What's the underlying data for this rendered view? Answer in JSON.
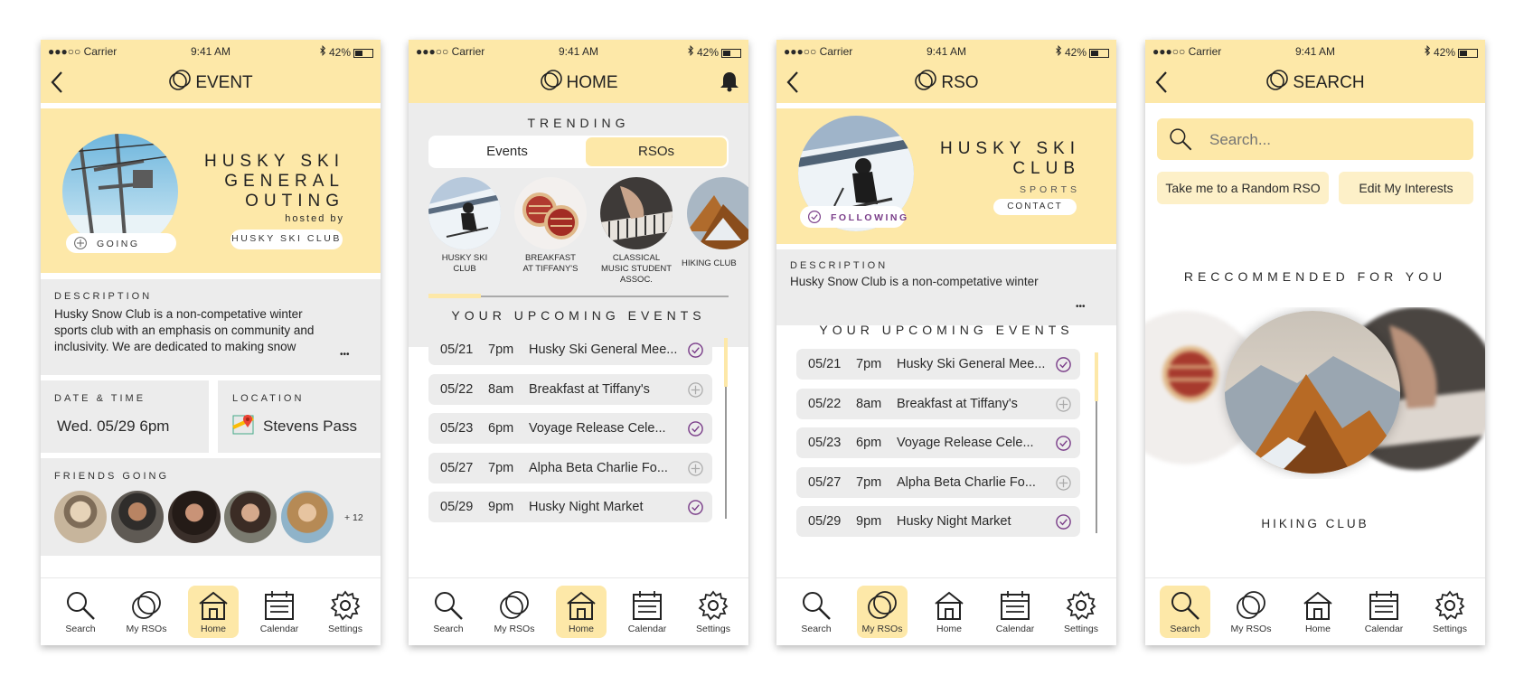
{
  "status": {
    "carrier": "●●●○○ Carrier",
    "time": "9:41 AM",
    "battery": "42%"
  },
  "colors": {
    "accent": "#fde8a8",
    "panel": "#ececec",
    "check": "#7b3f8a"
  },
  "nav": {
    "search": "Search",
    "my_rsos": "My RSOs",
    "home": "Home",
    "calendar": "Calendar",
    "settings": "Settings"
  },
  "event_screen": {
    "title": "EVENT",
    "event_name": [
      "HUSKY SKI",
      "GENERAL",
      "OUTING"
    ],
    "hosted_by": "hosted by",
    "host": "HUSKY SKI CLUB",
    "going": "GOING",
    "description_label": "DESCRIPTION",
    "description": "Husky Snow Club is a non-competative winter sports club with an emphasis on community and inclusivity. We are dedicated to making snow",
    "more": "•••",
    "date_label": "DATE & TIME",
    "date_value": "Wed. 05/29 6pm",
    "location_label": "LOCATION",
    "location_value": "Stevens Pass",
    "friends_label": "FRIENDS GOING",
    "friends_more": "+ 12"
  },
  "home_screen": {
    "title": "HOME",
    "trending": "TRENDING",
    "tabs": [
      "Events",
      "RSOs"
    ],
    "rsos": [
      {
        "line1": "HUSKY SKI",
        "line2": "CLUB",
        "line3": ""
      },
      {
        "line1": "BREAKFAST",
        "line2": "AT TIFFANY'S",
        "line3": ""
      },
      {
        "line1": "CLASSICAL",
        "line2": "MUSIC STUDENT",
        "line3": "ASSOC."
      },
      {
        "line1": "HIKING CLUB",
        "line2": "",
        "line3": ""
      }
    ],
    "upcoming": "YOUR UPCOMING EVENTS"
  },
  "events": [
    {
      "date": "05/21",
      "time": "7pm",
      "name": "Husky Ski General Mee...",
      "status": "going"
    },
    {
      "date": "05/22",
      "time": "8am",
      "name": "Breakfast at Tiffany's",
      "status": "add"
    },
    {
      "date": "05/23",
      "time": "6pm",
      "name": "Voyage Release Cele...",
      "status": "going"
    },
    {
      "date": "05/27",
      "time": "7pm",
      "name": "Alpha Beta Charlie Fo...",
      "status": "add"
    },
    {
      "date": "05/29",
      "time": "9pm",
      "name": "Husky Night Market",
      "status": "going"
    }
  ],
  "rso_screen": {
    "title": "RSO",
    "name": [
      "HUSKY SKI",
      "CLUB"
    ],
    "category": "SPORTS",
    "contact": "CONTACT",
    "following": "FOLLOWING",
    "description_label": "DESCRIPTION",
    "description": "Husky Snow Club is a non-competative winter",
    "more": "•••",
    "upcoming": "YOUR UPCOMING EVENTS"
  },
  "search_screen": {
    "title": "SEARCH",
    "placeholder": "Search...",
    "random_button": "Take me to a Random RSO",
    "interests_button": "Edit My Interests",
    "recommended": "RECCOMMENDED FOR YOU",
    "featured": "HIKING CLUB"
  }
}
